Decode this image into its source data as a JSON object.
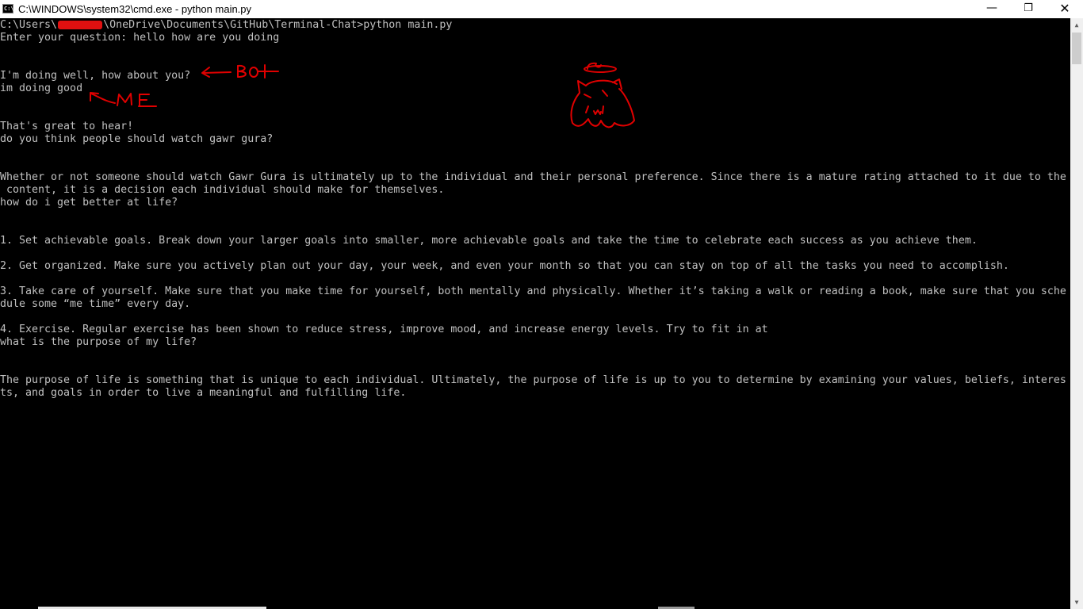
{
  "window": {
    "title": "C:\\WINDOWS\\system32\\cmd.exe - python  main.py",
    "controls": {
      "minimize": "—",
      "maximize": "❐",
      "close": "✕"
    }
  },
  "console": {
    "prompt_prefix": "C:\\Users\\",
    "prompt_suffix": "\\OneDrive\\Documents\\GitHub\\Terminal-Chat>python main.py",
    "lines": [
      "Enter your question: hello how are you doing",
      "I'm doing well, how about you?",
      "im doing good",
      "That's great to hear!",
      "do you think people should watch gawr gura?",
      "Whether or not someone should watch Gawr Gura is ultimately up to the individual and their personal preference. Since there is a mature rating attached to it due to the",
      " content, it is a decision each individual should make for themselves.",
      "how do i get better at life?",
      "1. Set achievable goals. Break down your larger goals into smaller, more achievable goals and take the time to celebrate each success as you achieve them.",
      "2. Get organized. Make sure you actively plan out your day, your week, and even your month so that you can stay on top of all the tasks you need to accomplish.",
      "3. Take care of yourself. Make sure that you make time for yourself, both mentally and physically. Whether it’s taking a walk or reading a book, make sure that you sche",
      "dule some “me time” every day.",
      "4. Exercise. Regular exercise has been shown to reduce stress, improve mood, and increase energy levels. Try to fit in at",
      "what is the purpose of my life?",
      "The purpose of life is something that is unique to each individual. Ultimately, the purpose of life is up to you to determine by examining your values, beliefs, interes",
      "ts, and goals in order to live a meaningful and fulfilling life."
    ]
  },
  "annotations": {
    "bot_label": "BOT",
    "me_label": "ME",
    "color": "#e00000"
  },
  "colors": {
    "console_bg": "#000000",
    "console_text": "#c0c0c0",
    "titlebar_bg": "#ffffff"
  }
}
